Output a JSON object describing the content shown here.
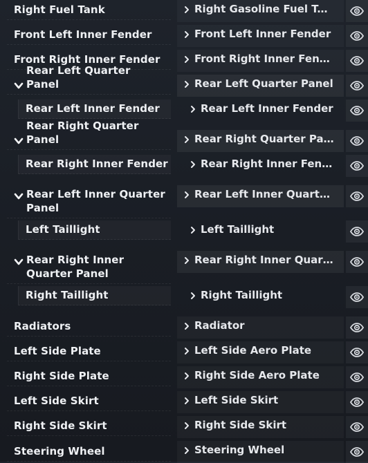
{
  "rows": [
    {
      "kind": "part",
      "left": "Right Fuel Tank",
      "right": "Right Gasoline Fuel Tank"
    },
    {
      "kind": "part",
      "left": "Front Left Inner Fender",
      "right": "Front Left Inner Fender"
    },
    {
      "kind": "part",
      "left": "Front Right Inner Fender",
      "right": "Front Right Inner Fender"
    },
    {
      "kind": "group",
      "left": "Rear Left Quarter Panel",
      "right": "Rear Left Quarter Panel"
    },
    {
      "kind": "child",
      "left": "Rear Left Inner Fender",
      "right": "Rear Left Inner Fender"
    },
    {
      "kind": "group",
      "left": "Rear Right Quarter Panel",
      "right": "Rear Right Quarter Panel"
    },
    {
      "kind": "child",
      "left": "Rear Right Inner Fender",
      "right": "Rear Right Inner Fender"
    },
    {
      "kind": "group",
      "left": "Rear Left Inner Quarter Panel",
      "right": "Rear Left Inner Quarter P..."
    },
    {
      "kind": "child",
      "left": "Left Taillight",
      "right": "Left Taillight"
    },
    {
      "kind": "group",
      "left": "Rear Right Inner Quarter Panel",
      "right": "Rear Right Inner Quarter ..."
    },
    {
      "kind": "child",
      "left": "Right Taillight",
      "right": "Right Taillight"
    },
    {
      "kind": "part",
      "left": "Radiators",
      "right": "Radiator"
    },
    {
      "kind": "part",
      "left": "Left Side Plate",
      "right": "Left Side Aero Plate"
    },
    {
      "kind": "part",
      "left": "Right Side Plate",
      "right": "Right Side Aero Plate"
    },
    {
      "kind": "part",
      "left": "Left Side Skirt",
      "right": "Left Side Skirt"
    },
    {
      "kind": "part",
      "left": "Right Side Skirt",
      "right": "Right Side Skirt"
    },
    {
      "kind": "part",
      "left": "Steering Wheel",
      "right": "Steering Wheel"
    }
  ],
  "icons": {
    "expand": "chevron-down-icon",
    "select": "chevron-right-icon",
    "visibility": "eye-icon"
  }
}
